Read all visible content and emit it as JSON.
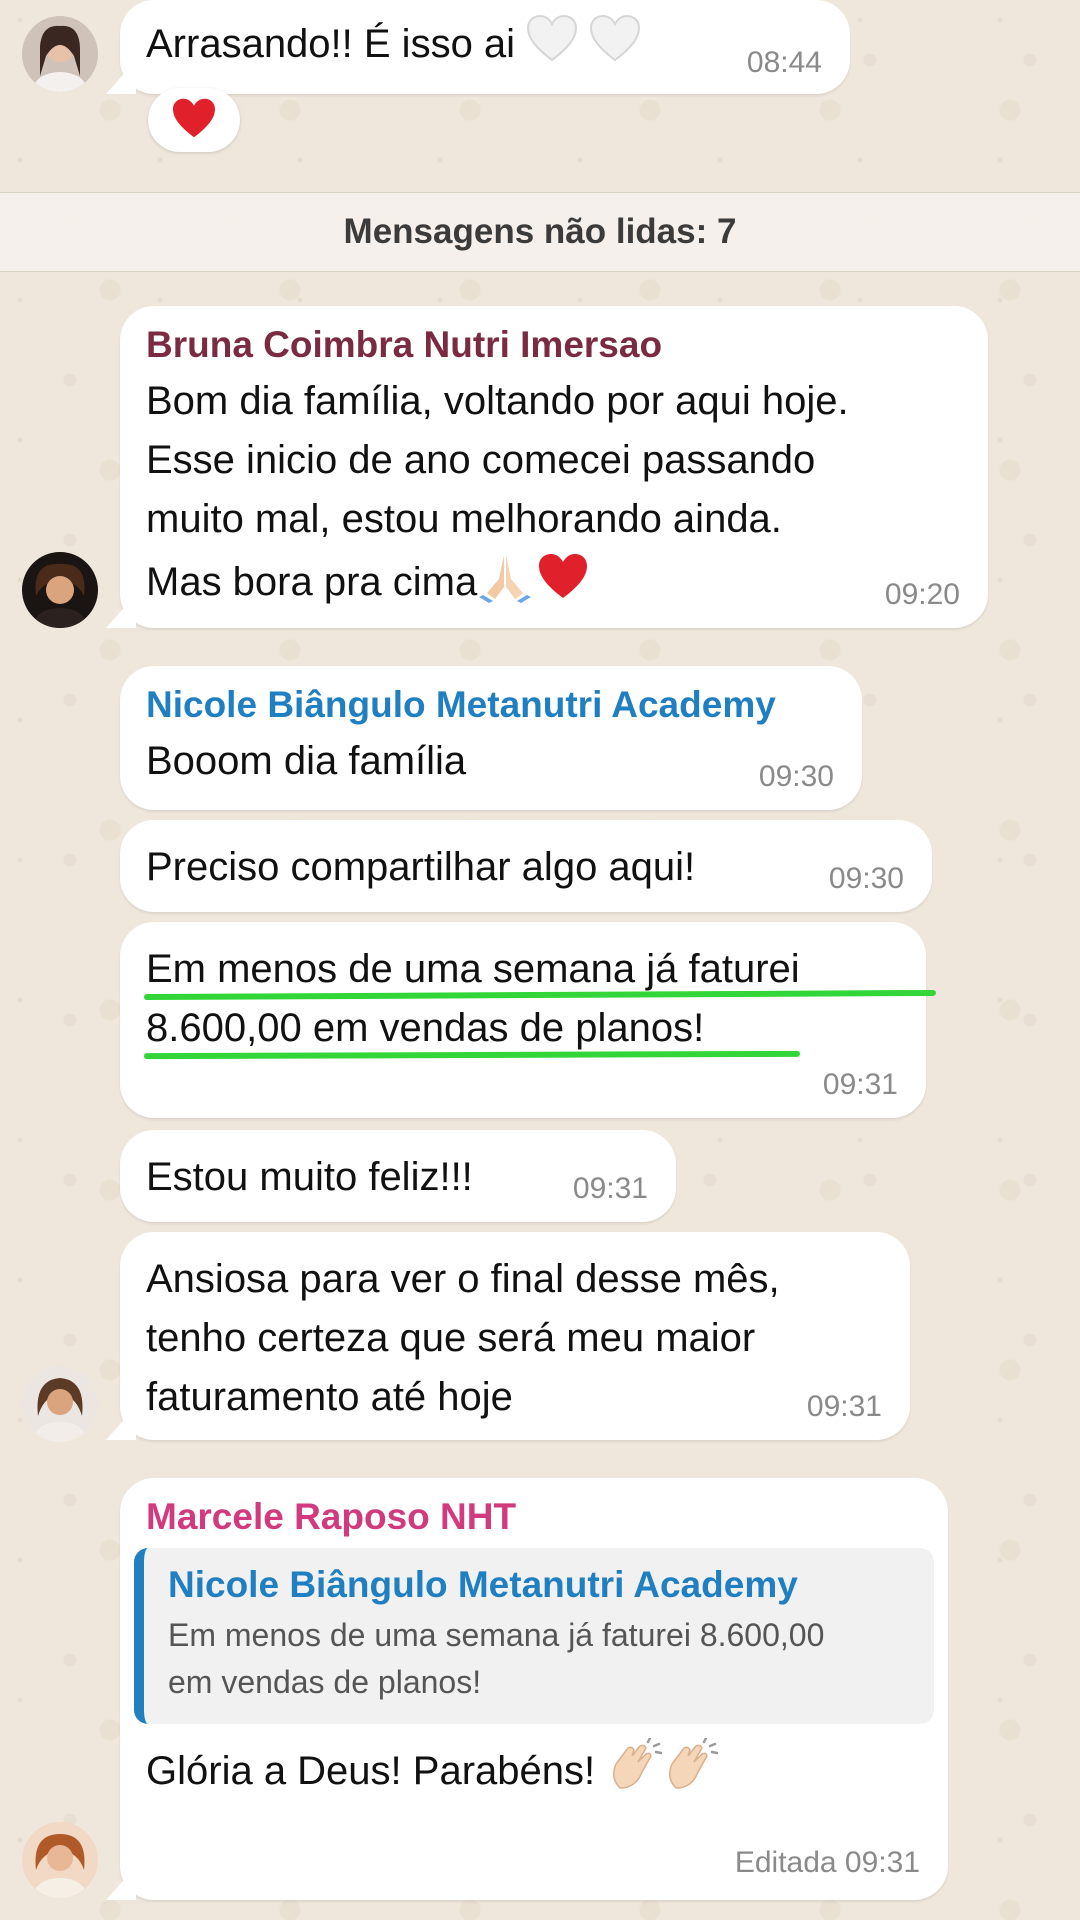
{
  "messages": {
    "m0": {
      "text": "Arrasando!! É isso ai",
      "time": "08:44",
      "reaction": "heart-red"
    },
    "unread_divider": "Mensagens não lidas: 7",
    "m1": {
      "sender": "Bruna Coimbra Nutri Imersao",
      "lines": [
        "Bom dia família, voltando por aqui hoje.",
        "Esse inicio de ano comecei passando",
        "muito mal, estou melhorando ainda.",
        "Mas bora pra cima"
      ],
      "time": "09:20"
    },
    "m2": {
      "sender": "Nicole Biângulo Metanutri Academy",
      "text": "Booom dia família",
      "time": "09:30"
    },
    "m3": {
      "text": "Preciso compartilhar algo aqui!",
      "time": "09:30"
    },
    "m4": {
      "lines": [
        "Em menos de uma semana já faturei",
        "8.600,00 em vendas de planos!"
      ],
      "time": "09:31"
    },
    "m5": {
      "text": "Estou muito feliz!!!",
      "time": "09:31"
    },
    "m6": {
      "lines": [
        "Ansiosa para ver o final desse mês,",
        "tenho certeza que será meu maior",
        "faturamento até hoje"
      ],
      "time": "09:31"
    },
    "m7": {
      "sender": "Marcele Raposo NHT",
      "quote_sender": "Nicole Biângulo Metanutri Academy",
      "quote_lines": [
        "Em menos de uma semana já faturei 8.600,00",
        "em vendas de planos!"
      ],
      "text": "Glória a Deus! Parabéns!",
      "time": "Editada 09:31"
    }
  },
  "colors": {
    "bruna_name": "#7a2b42",
    "nicole_name": "#1f7fc1",
    "marcele_name": "#d13a7c",
    "highlight_underline": "#33d639",
    "chat_background": "#efe7dc"
  },
  "icons": [
    "white-heart-icon",
    "red-heart-icon",
    "praying-hands-icon",
    "clapping-hands-icon"
  ]
}
